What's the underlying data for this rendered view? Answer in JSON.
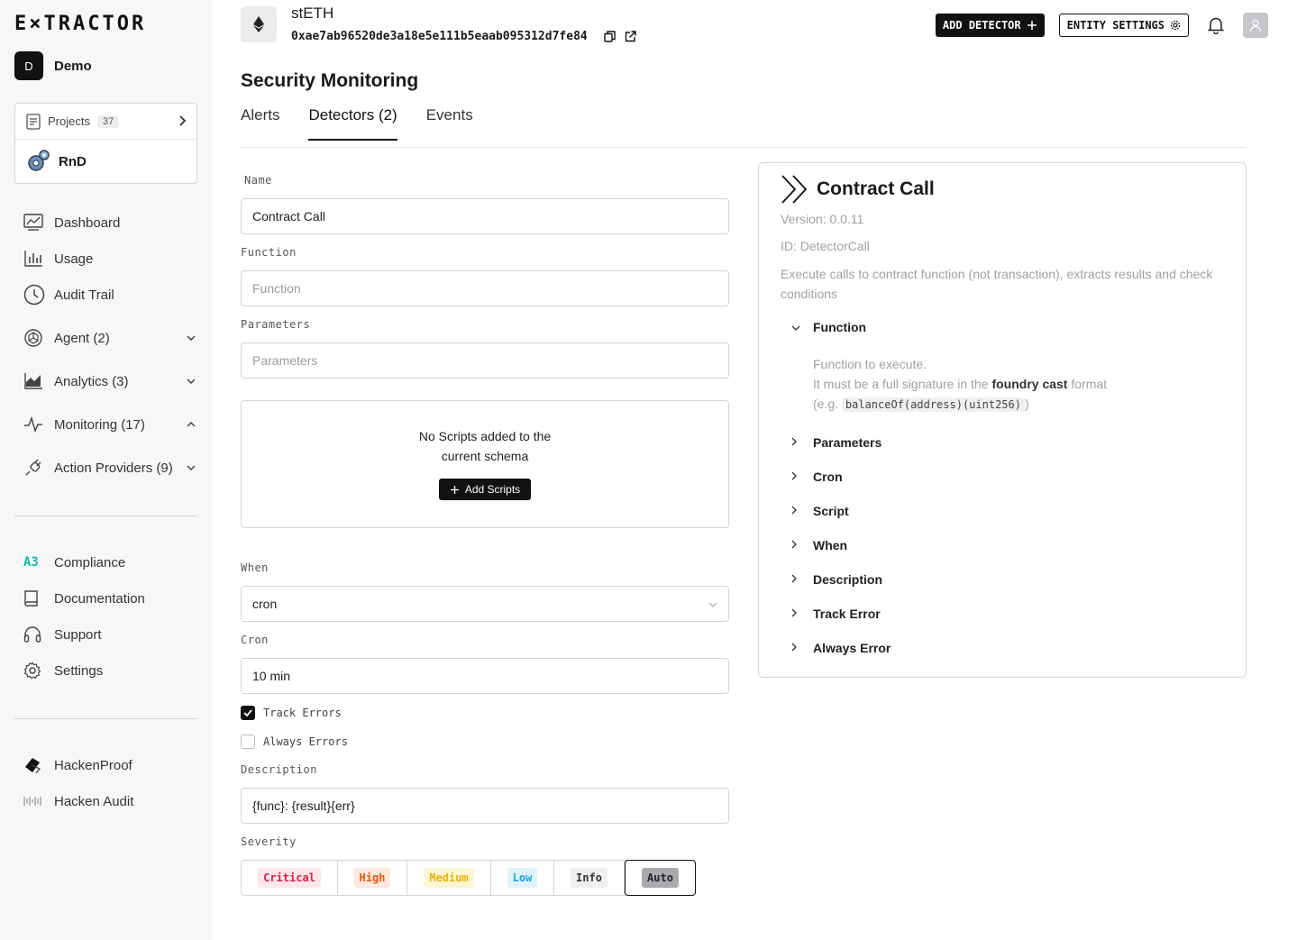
{
  "app": {
    "logo": "E×TRACTOR"
  },
  "org": {
    "initial": "D",
    "name": "Demo"
  },
  "project": {
    "label": "Projects",
    "count": "37",
    "current": "RnD"
  },
  "nav": {
    "main": [
      {
        "label": "Dashboard",
        "icon": "dashboard-icon"
      },
      {
        "label": "Usage",
        "icon": "bar-chart-icon"
      },
      {
        "label": "Audit Trail",
        "icon": "clock-icon"
      },
      {
        "label": "Agent (2)",
        "icon": "agent-icon"
      },
      {
        "label": "Analytics (3)",
        "icon": "analytics-icon"
      },
      {
        "label": "Monitoring (17)",
        "icon": "pulse-icon"
      },
      {
        "label": "Action Providers (9)",
        "icon": "plug-icon"
      }
    ],
    "secondary": [
      {
        "label": "Compliance",
        "icon": "compliance-icon"
      },
      {
        "label": "Documentation",
        "icon": "book-icon"
      },
      {
        "label": "Support",
        "icon": "headset-icon"
      },
      {
        "label": "Settings",
        "icon": "gear-icon"
      }
    ],
    "external": [
      {
        "label": "HackenProof",
        "icon": "hackenproof-icon"
      },
      {
        "label": "Hacken Audit",
        "icon": "hacken-audit-icon"
      }
    ]
  },
  "header": {
    "token_name": "stETH",
    "address": "0xae7ab96520de3a18e5e111b5eaab095312d7fe84",
    "add_detector": "ADD DETECTOR",
    "entity_settings": "ENTITY SETTINGS"
  },
  "page": {
    "title": "Security Monitoring",
    "tabs": [
      "Alerts",
      "Detectors (2)",
      "Events"
    ]
  },
  "form": {
    "name_label": "Name",
    "name_value": "Contract Call",
    "function_label": "Function",
    "function_placeholder": "Function",
    "parameters_label": "Parameters",
    "parameters_placeholder": "Parameters",
    "scripts_msg_1": "No Scripts added to the",
    "scripts_msg_2": "current schema",
    "add_scripts": "Add Scripts",
    "when_label": "When",
    "when_value": "cron",
    "cron_label": "Cron",
    "cron_value": "10 min",
    "track_errors": "Track Errors",
    "always_errors": "Always Errors",
    "description_label": "Description",
    "description_value": "{func}: {result}{err}",
    "severity_label": "Severity",
    "severity": [
      {
        "label": "Critical",
        "color": "#e11d48",
        "bg": "#fde7ea"
      },
      {
        "label": "High",
        "color": "#ea580c",
        "bg": "#fde9df"
      },
      {
        "label": "Medium",
        "color": "#eab308",
        "bg": "#fdf6d3"
      },
      {
        "label": "Low",
        "color": "#0ea5e9",
        "bg": "#e0f3fc"
      },
      {
        "label": "Info",
        "color": "#333333",
        "bg": "#efeff1"
      },
      {
        "label": "Auto",
        "color": "#222222",
        "bg": "#a9a9b0"
      }
    ]
  },
  "panel": {
    "title": "Contract Call",
    "version": "Version: 0.0.11",
    "id": "ID: DetectorCall",
    "description": "Execute calls to contract function (not transaction), extracts results and check conditions",
    "function_title": "Function",
    "function_help_1": "Function to execute.",
    "function_help_2a": "It must be a full signature in the ",
    "function_help_2b": "foundry cast",
    "function_help_2c": " format",
    "function_help_3a": "(e.g. ",
    "function_help_code": "balanceOf(address)(uint256)",
    "function_help_3b": ")",
    "sections": [
      "Parameters",
      "Cron",
      "Script",
      "When",
      "Description",
      "Track Error",
      "Always Error"
    ]
  }
}
